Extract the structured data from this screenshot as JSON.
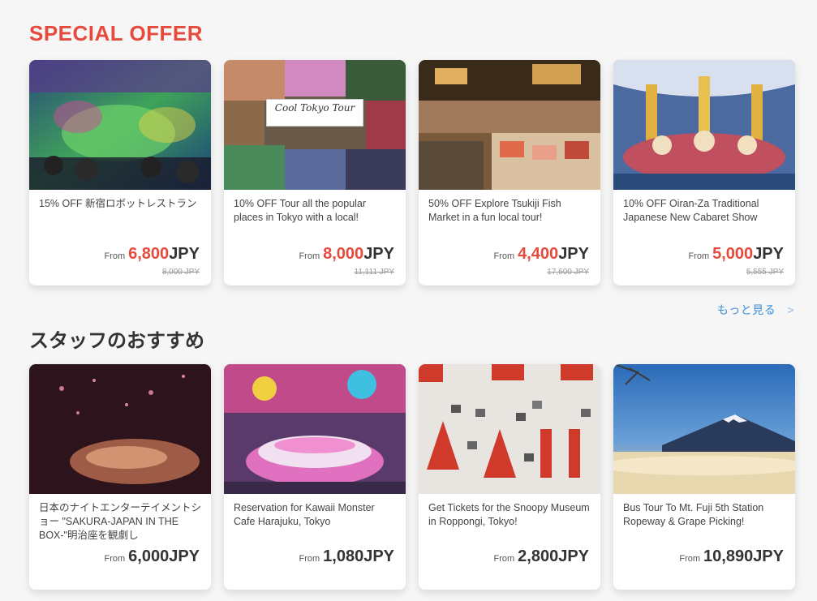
{
  "special_offer": {
    "title": "SPECIAL OFFER",
    "cards": [
      {
        "title": "15% OFF 新宿ロボットレストラン",
        "from": "From",
        "price": "6,800",
        "currency": "JPY",
        "old_price": "8,000 JPY",
        "image": "robot-restaurant-photo"
      },
      {
        "title": "10% OFF Tour all the popular places in Tokyo with a local!",
        "from": "From",
        "price": "8,000",
        "currency": "JPY",
        "old_price": "11,111 JPY",
        "image": "cool-tokyo-tour-photo",
        "sign": "Cool Tokyo Tour"
      },
      {
        "title": "50% OFF Explore Tsukiji Fish Market in a fun local tour!",
        "from": "From",
        "price": "4,400",
        "currency": "JPY",
        "old_price": "17,600 JPY",
        "image": "tsukiji-market-photo"
      },
      {
        "title": "10% OFF Oiran-Za Traditional Japanese New Cabaret Show",
        "from": "From",
        "price": "5,000",
        "currency": "JPY",
        "old_price": "5,555 JPY",
        "image": "oiran-show-photo"
      }
    ]
  },
  "more_link": {
    "label": "もっと見る",
    "chevron": ">"
  },
  "staff_picks": {
    "title": "スタッフのおすすめ",
    "cards": [
      {
        "title": "日本のナイトエンターテイメントショー \"SAKURA-JAPAN IN THE BOX-\"明治座を観劇し",
        "from": "From",
        "price": "6,000JPY",
        "image": "sakura-show-photo"
      },
      {
        "title": "Reservation for Kawaii Monster Cafe Harajuku, Tokyo",
        "from": "From",
        "price": "1,080JPY",
        "image": "kawaii-monster-cafe-photo"
      },
      {
        "title": "Get Tickets for the Snoopy Museum in Roppongi, Tokyo!",
        "from": "From",
        "price": "2,800JPY",
        "image": "snoopy-museum-photo"
      },
      {
        "title": "Bus Tour To Mt. Fuji 5th Station Ropeway & Grape Picking!",
        "from": "From",
        "price": "10,890JPY",
        "image": "mt-fuji-photo"
      }
    ]
  },
  "colors": {
    "accent": "#e64a3c",
    "link": "#3d8fd8"
  }
}
